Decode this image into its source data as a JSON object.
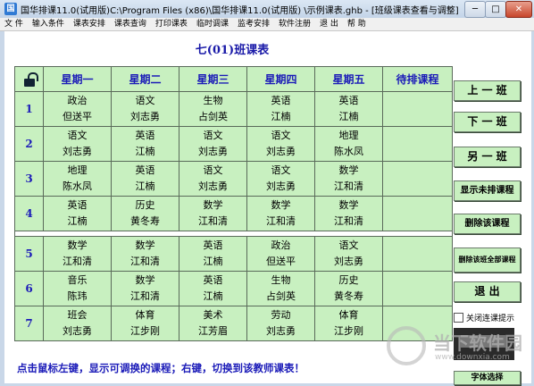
{
  "window": {
    "title": "国华排课11.0(试用版)C:\\Program Files (x86)\\国华排课11.0(试用版) \\示例课表.ghb - [班级课表查看与调整]",
    "icon": "app-icon",
    "min": "─",
    "max": "□",
    "close": "✕"
  },
  "menu": [
    "文 件",
    "输入条件",
    "课表安排",
    "课表查询",
    "打印课表",
    "临时调课",
    "监考安排",
    "软件注册",
    "退 出",
    "帮 助"
  ],
  "caption": "七(01)班课表",
  "days": [
    "星期一",
    "星期二",
    "星期三",
    "星期四",
    "星期五",
    "待排课程"
  ],
  "periods": [
    {
      "label": "1",
      "cells": [
        {
          "s": "政治",
          "t": "但送平"
        },
        {
          "s": "语文",
          "t": "刘志勇"
        },
        {
          "s": "生物",
          "t": "占剑英"
        },
        {
          "s": "英语",
          "t": "江楠"
        },
        {
          "s": "英语",
          "t": "江楠"
        },
        {
          "s": "",
          "t": ""
        }
      ]
    },
    {
      "label": "2",
      "cells": [
        {
          "s": "语文",
          "t": "刘志勇"
        },
        {
          "s": "英语",
          "t": "江楠"
        },
        {
          "s": "语文",
          "t": "刘志勇"
        },
        {
          "s": "语文",
          "t": "刘志勇"
        },
        {
          "s": "地理",
          "t": "陈水凤"
        },
        {
          "s": "",
          "t": ""
        }
      ]
    },
    {
      "label": "3",
      "cells": [
        {
          "s": "地理",
          "t": "陈水凤"
        },
        {
          "s": "英语",
          "t": "江楠"
        },
        {
          "s": "语文",
          "t": "刘志勇"
        },
        {
          "s": "语文",
          "t": "刘志勇"
        },
        {
          "s": "数学",
          "t": "江和清"
        },
        {
          "s": "",
          "t": ""
        }
      ]
    },
    {
      "label": "4",
      "cells": [
        {
          "s": "英语",
          "t": "江楠"
        },
        {
          "s": "历史",
          "t": "黄冬寿"
        },
        {
          "s": "数学",
          "t": "江和清"
        },
        {
          "s": "数学",
          "t": "江和清"
        },
        {
          "s": "数学",
          "t": "江和清"
        },
        {
          "s": "",
          "t": ""
        }
      ]
    },
    {
      "label": "5",
      "cells": [
        {
          "s": "数学",
          "t": "江和清"
        },
        {
          "s": "数学",
          "t": "江和清"
        },
        {
          "s": "英语",
          "t": "江楠"
        },
        {
          "s": "政治",
          "t": "但送平"
        },
        {
          "s": "语文",
          "t": "刘志勇"
        },
        {
          "s": "",
          "t": ""
        }
      ]
    },
    {
      "label": "6",
      "cells": [
        {
          "s": "音乐",
          "t": "陈玮"
        },
        {
          "s": "数学",
          "t": "江和清"
        },
        {
          "s": "英语",
          "t": "江楠"
        },
        {
          "s": "生物",
          "t": "占剑英"
        },
        {
          "s": "历史",
          "t": "黄冬寿"
        },
        {
          "s": "",
          "t": ""
        }
      ]
    },
    {
      "label": "7",
      "cells": [
        {
          "s": "班会",
          "t": "刘志勇"
        },
        {
          "s": "体育",
          "t": "江步刚"
        },
        {
          "s": "美术",
          "t": "江芳眉"
        },
        {
          "s": "劳动",
          "t": "刘志勇"
        },
        {
          "s": "体育",
          "t": "江步刚"
        },
        {
          "s": "",
          "t": ""
        }
      ]
    }
  ],
  "buttons": [
    "上 一 班",
    "下 一 班",
    "另 一 班",
    "显示未排课程",
    "删除该课程",
    "删除该班全部课程",
    "退 出",
    "字体选择"
  ],
  "checkbox_label": "关闭连课提示",
  "hint": "点击鼠标左键，显示可调换的课程；右键，切换到该教师课表！",
  "watermark": {
    "title": "当下软件园",
    "url": "www.downxia.com"
  },
  "colors": {
    "cell_bg": "#c8f0c0",
    "header_text": "#1a1ab8"
  }
}
